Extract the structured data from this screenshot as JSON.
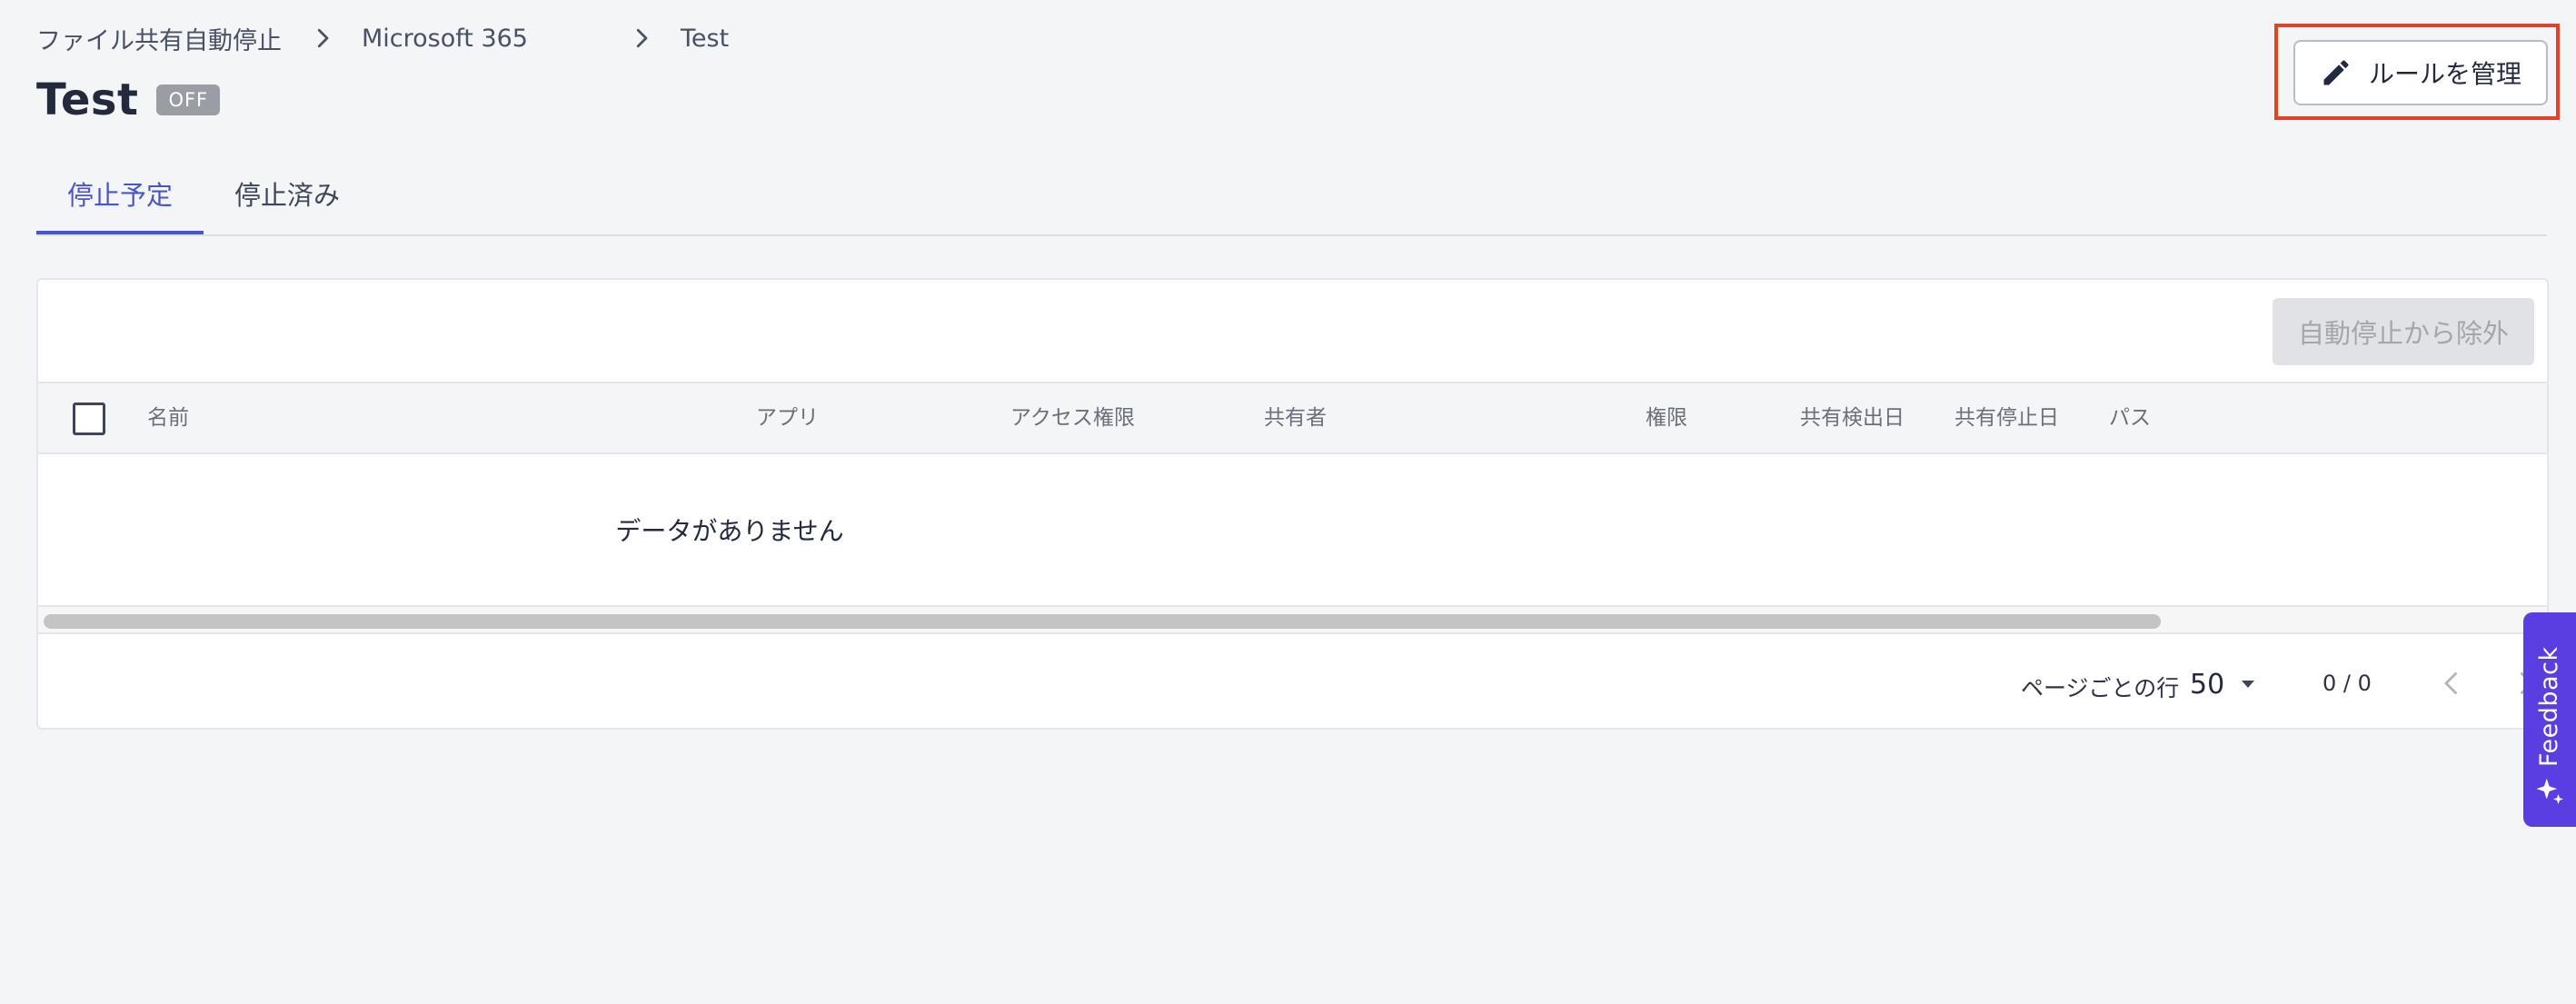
{
  "breadcrumb": {
    "items": [
      "ファイル共有自動停止",
      "Microsoft 365",
      "Test"
    ]
  },
  "page": {
    "title": "Test",
    "status": "OFF"
  },
  "toolbar": {
    "manage_rules_label": "ルールを管理"
  },
  "tabs": [
    {
      "label": "停止予定",
      "active": true
    },
    {
      "label": "停止済み",
      "active": false
    }
  ],
  "table": {
    "exclude_button_label": "自動停止から除外",
    "columns": [
      "名前",
      "アプリ",
      "アクセス権限",
      "共有者",
      "権限",
      "共有検出日",
      "共有停止日",
      "パス"
    ],
    "empty_message": "データがありません"
  },
  "pagination": {
    "rows_per_page_label": "ページごとの行",
    "rows_per_page_value": "50",
    "range": "0 / 0"
  },
  "feedback": {
    "label": "Feedback"
  },
  "colors": {
    "accent": "#4b55c9",
    "feedback": "#5b3ee0",
    "highlight": "#e04328"
  }
}
